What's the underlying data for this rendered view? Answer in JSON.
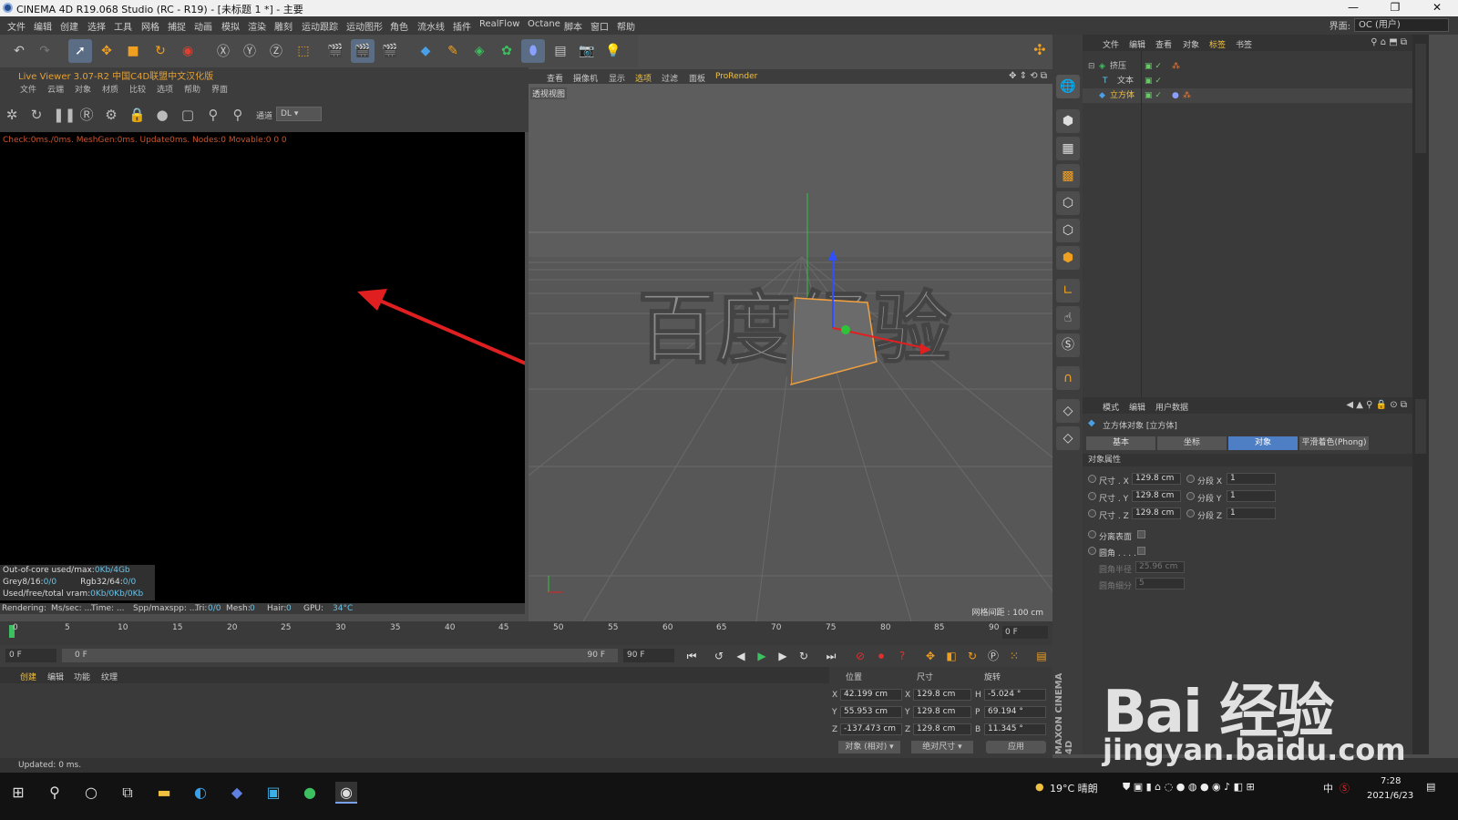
{
  "window": {
    "title": "CINEMA 4D R19.068 Studio (RC - R19) - [未标题 1 *] - 主要",
    "controls": [
      "—",
      "❐",
      "✕"
    ]
  },
  "menubar": {
    "items": [
      "文件",
      "编辑",
      "创建",
      "选择",
      "工具",
      "网格",
      "捕捉",
      "动画",
      "模拟",
      "渲染",
      "雕刻",
      "运动跟踪",
      "运动图形",
      "角色",
      "流水线",
      "插件",
      "RealFlow",
      "Octane",
      "脚本",
      "窗口",
      "帮助"
    ],
    "layout_label": "界面:",
    "layout_value": "OC (用户)"
  },
  "live_viewer": {
    "header": "Live Viewer 3.07-R2 中国C4D联盟中文汉化版",
    "menu": [
      "文件",
      "云端",
      "对象",
      "材质",
      "比较",
      "选项",
      "帮助",
      "界面"
    ],
    "channel_label": "通道",
    "channel_value": "DL",
    "status_line": "Check:0ms./0ms. MeshGen:0ms. Update0ms. Nodes:0 Movable:0  0 0",
    "vram": [
      {
        "label": "Out-of-core used/max:",
        "value": "0Kb/4Gb"
      },
      {
        "label": "Grey8/16:",
        "value": "0/0",
        "label2": "Rgb32/64:",
        "value2": "0/0"
      },
      {
        "label": "Used/free/total vram:",
        "value": "0Kb/0Kb/0Kb"
      }
    ],
    "render_status": {
      "rendering": "Rendering:",
      "mssec": "Ms/sec: ...",
      "time": "Time: ...",
      "spp": "Spp/maxspp: ...",
      "tri_label": "Tri:",
      "tri": "0/0",
      "mesh_label": "Mesh:",
      "mesh": "0",
      "hair_label": "Hair:",
      "hair": "0",
      "gpu_label": "GPU:",
      "gpu": "34°C"
    }
  },
  "viewport": {
    "menu": [
      "查看",
      "摄像机",
      "显示",
      "选项",
      "过滤",
      "面板",
      "ProRender"
    ],
    "view_label": "透视视图",
    "grid_text": "网格间距 : 100 cm",
    "scene_text": "百度经验"
  },
  "object_manager": {
    "menu": [
      "文件",
      "编辑",
      "查看",
      "对象",
      "标签",
      "书签"
    ],
    "objects": [
      {
        "name": "挤压",
        "depth": 0,
        "selected": false
      },
      {
        "name": "文本",
        "depth": 1,
        "selected": false
      },
      {
        "name": "立方体",
        "depth": 1,
        "selected": true
      }
    ]
  },
  "attributes": {
    "menu": [
      "模式",
      "编辑",
      "用户数据"
    ],
    "title": "立方体对象 [立方体]",
    "tabs": [
      "基本",
      "坐标",
      "对象",
      "平滑着色(Phong)"
    ],
    "selected_tab": "对象",
    "section": "对象属性",
    "rows": [
      {
        "label": "尺寸 . X",
        "value": "129.8 cm",
        "seg_label": "分段 X",
        "seg_value": "1"
      },
      {
        "label": "尺寸 . Y",
        "value": "129.8 cm",
        "seg_label": "分段 Y",
        "seg_value": "1"
      },
      {
        "label": "尺寸 . Z",
        "value": "129.8 cm",
        "seg_label": "分段 Z",
        "seg_value": "1"
      }
    ],
    "separate_label": "分离表面",
    "fillet_label": "圆角 . . . .",
    "fillet_radius_label": "圆角半径",
    "fillet_radius_value": "25.96 cm",
    "fillet_sub_label": "圆角细分",
    "fillet_sub_value": "5"
  },
  "timeline": {
    "ticks": [
      "0",
      "5",
      "10",
      "15",
      "20",
      "25",
      "30",
      "35",
      "40",
      "45",
      "50",
      "55",
      "60",
      "65",
      "70",
      "75",
      "80",
      "85",
      "90"
    ],
    "current_frame": "0 F",
    "start_field": "0 F",
    "range_start": "0 F",
    "range_end": "90 F",
    "end_field": "90 F"
  },
  "material_manager": {
    "menu": [
      "创建",
      "编辑",
      "功能",
      "纹理"
    ]
  },
  "coordinates": {
    "headers": [
      "位置",
      "尺寸",
      "旋转"
    ],
    "rows": [
      {
        "axis": "X",
        "pos": "42.199 cm",
        "saxis": "X",
        "size": "129.8 cm",
        "raxis": "H",
        "rot": "-5.024 °"
      },
      {
        "axis": "Y",
        "pos": "55.953 cm",
        "saxis": "Y",
        "size": "129.8 cm",
        "raxis": "P",
        "rot": "69.194 °"
      },
      {
        "axis": "Z",
        "pos": "-137.473 cm",
        "saxis": "Z",
        "size": "129.8 cm",
        "raxis": "B",
        "rot": "11.345 °"
      }
    ],
    "mode1": "对象 (相对)",
    "mode2": "绝对尺寸",
    "apply": "应用"
  },
  "maxon_brand": "MAXON CINEMA 4D",
  "status": "Updated: 0 ms.",
  "taskbar": {
    "weather": "19°C 晴朗",
    "ime": "中",
    "time": "7:28",
    "date": "2021/6/23"
  },
  "watermark": {
    "brand": "Bai 经验",
    "url": "jingyan.baidu.com"
  }
}
